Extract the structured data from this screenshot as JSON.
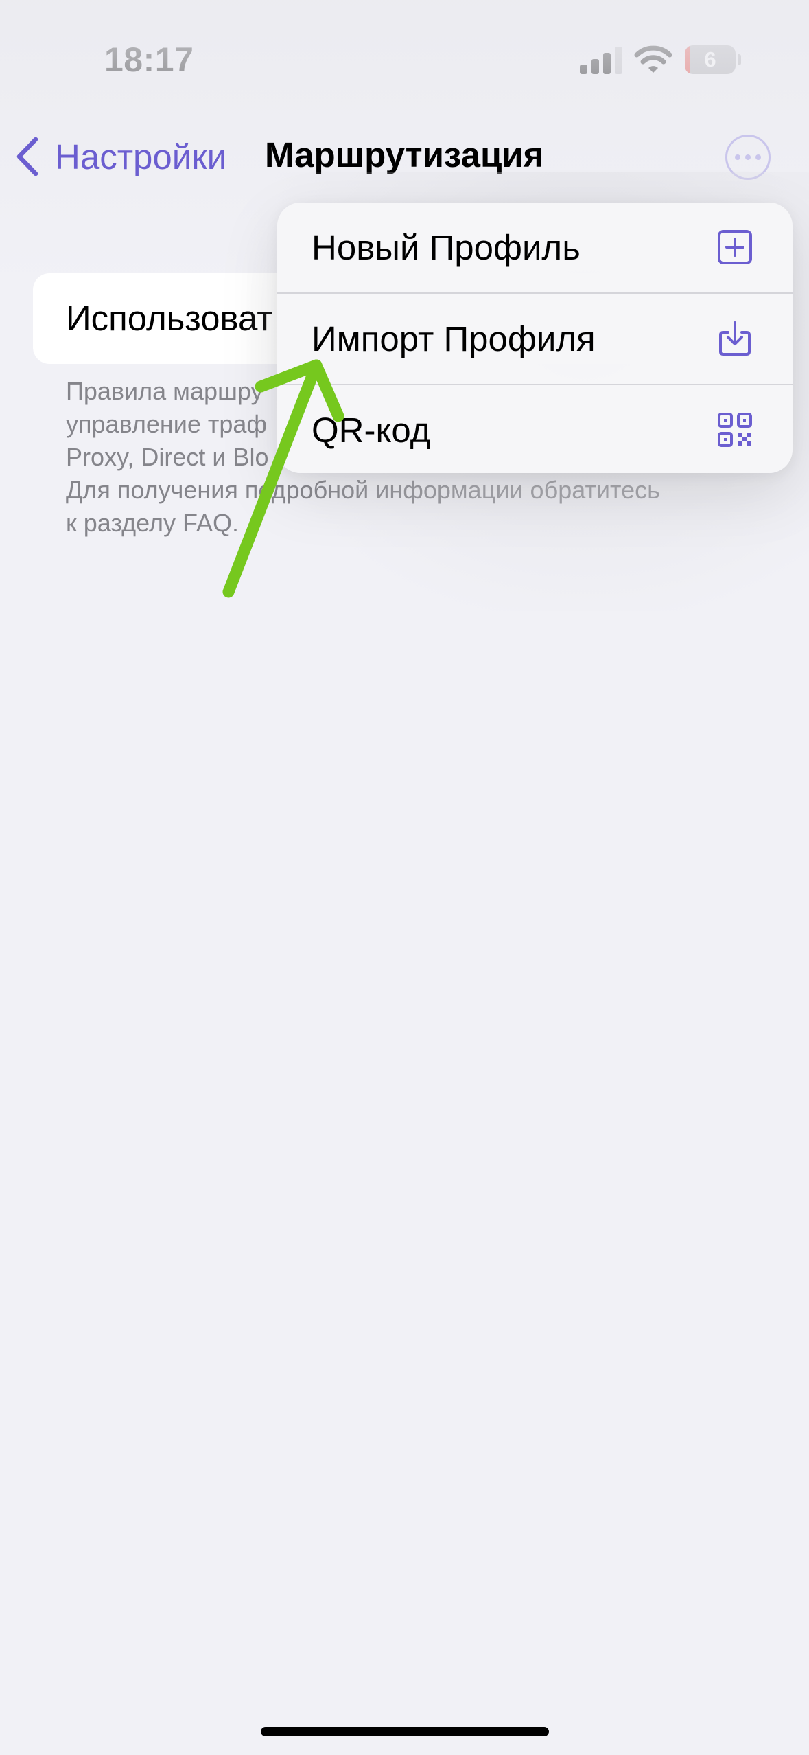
{
  "status_bar": {
    "time": "18:17",
    "battery_level": "6",
    "icons": [
      "signal-icon",
      "wifi-icon",
      "battery-icon"
    ]
  },
  "nav": {
    "back_label": "Настройки",
    "title": "Маршрутизация",
    "more_icon": "ellipsis-circle-icon"
  },
  "content": {
    "card_label": "Использоват",
    "footer_lines": [
      "Правила маршру",
      "управление траф",
      "Proxy, Direct и Blo",
      "Для получения подробной информации обратитесь",
      "к разделу FAQ."
    ]
  },
  "menu": {
    "items": [
      {
        "label": "Новый Профиль",
        "icon": "plus-square-icon"
      },
      {
        "label": "Импорт Профиля",
        "icon": "import-icon"
      },
      {
        "label": "QR-код",
        "icon": "qr-code-icon"
      }
    ]
  },
  "colors": {
    "accent": "#6b5ed0",
    "annotation_arrow": "#76c81e",
    "background": "#f1f1f6",
    "footer_text": "#85858b"
  }
}
